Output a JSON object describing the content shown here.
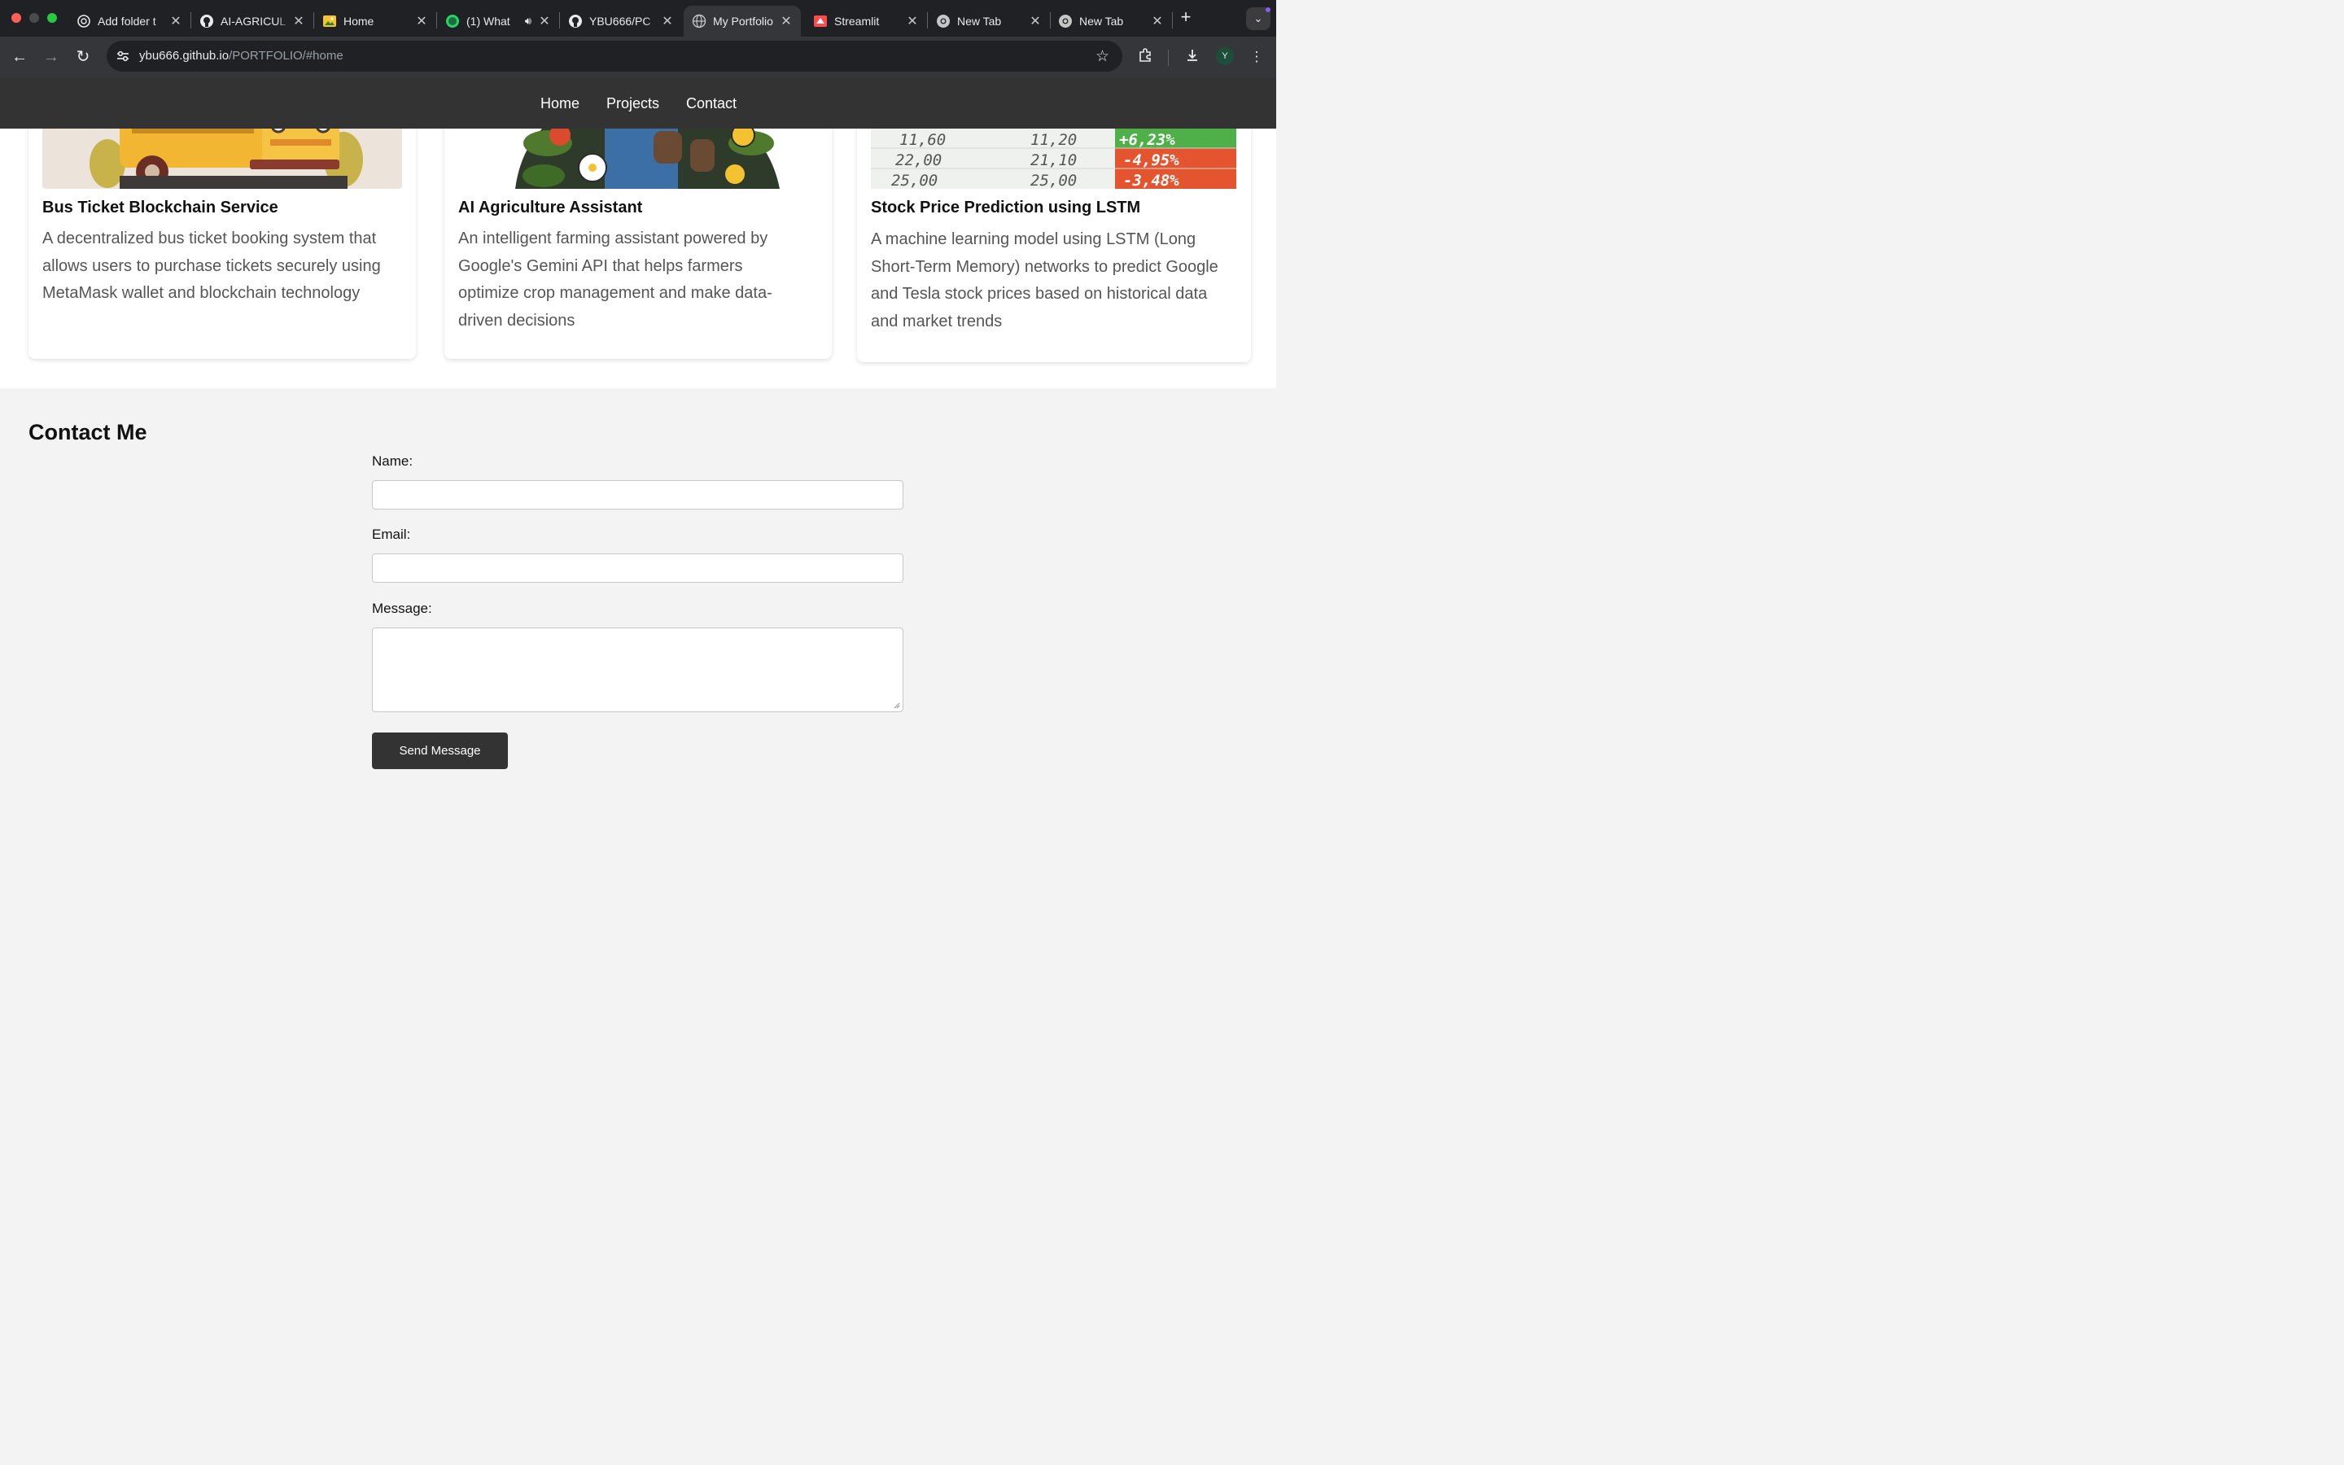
{
  "browser": {
    "tabs": [
      {
        "title": "Add folder t",
        "favicon": "chatgpt-icon",
        "active": false
      },
      {
        "title": "AI-AGRICUL",
        "favicon": "github-icon",
        "active": false
      },
      {
        "title": "Home",
        "favicon": "image-icon",
        "active": false
      },
      {
        "title": "(1) What",
        "favicon": "whatsapp-icon",
        "active": false,
        "audio": true
      },
      {
        "title": "YBU666/PC",
        "favicon": "github-icon",
        "active": false
      },
      {
        "title": "My Portfolio",
        "favicon": "globe-icon",
        "active": true
      },
      {
        "title": "Streamlit",
        "favicon": "streamlit-icon",
        "active": false
      },
      {
        "title": "New Tab",
        "favicon": "chrome-icon",
        "active": false
      },
      {
        "title": "New Tab",
        "favicon": "chrome-icon",
        "active": false
      }
    ],
    "close_glyph": "✕",
    "new_tab_glyph": "+",
    "address": {
      "host": "ybu666.github.io",
      "path": "/PORTFOLIO/#home"
    },
    "profile_initial": "Y"
  },
  "site": {
    "nav": {
      "home": "Home",
      "projects": "Projects",
      "contact": "Contact"
    },
    "projects": [
      {
        "title": "Bus Ticket Blockchain Service",
        "description": "A decentralized bus ticket booking system that allows users to purchase tickets securely using MetaMask wallet and blockchain technology"
      },
      {
        "title": "AI Agriculture Assistant",
        "description": "An intelligent farming assistant powered by Google's Gemini API that helps farmers optimize crop management and make data-driven decisions"
      },
      {
        "title": "Stock Price Prediction using LSTM",
        "description": "A machine learning model using LSTM (Long Short-Term Memory) networks to predict Google and Tesla stock prices based on historical data and market trends"
      }
    ],
    "stock_image_rows": [
      {
        "c1": "11,60",
        "c2": "11,20",
        "c3": "+6,23%"
      },
      {
        "c1": "22,00",
        "c2": "21,10",
        "c3": "-4,95%"
      },
      {
        "c1": "25,00",
        "c2": "25,00",
        "c3": "-3,48%"
      }
    ],
    "contact": {
      "heading": "Contact Me",
      "name_label": "Name:",
      "email_label": "Email:",
      "message_label": "Message:",
      "name_value": "",
      "email_value": "",
      "message_value": "",
      "submit_label": "Send Message"
    }
  },
  "colors": {
    "nav_bg": "#333333",
    "button_bg": "#333333",
    "page_bg": "#f3f3f3",
    "chrome_bg": "#202124"
  }
}
